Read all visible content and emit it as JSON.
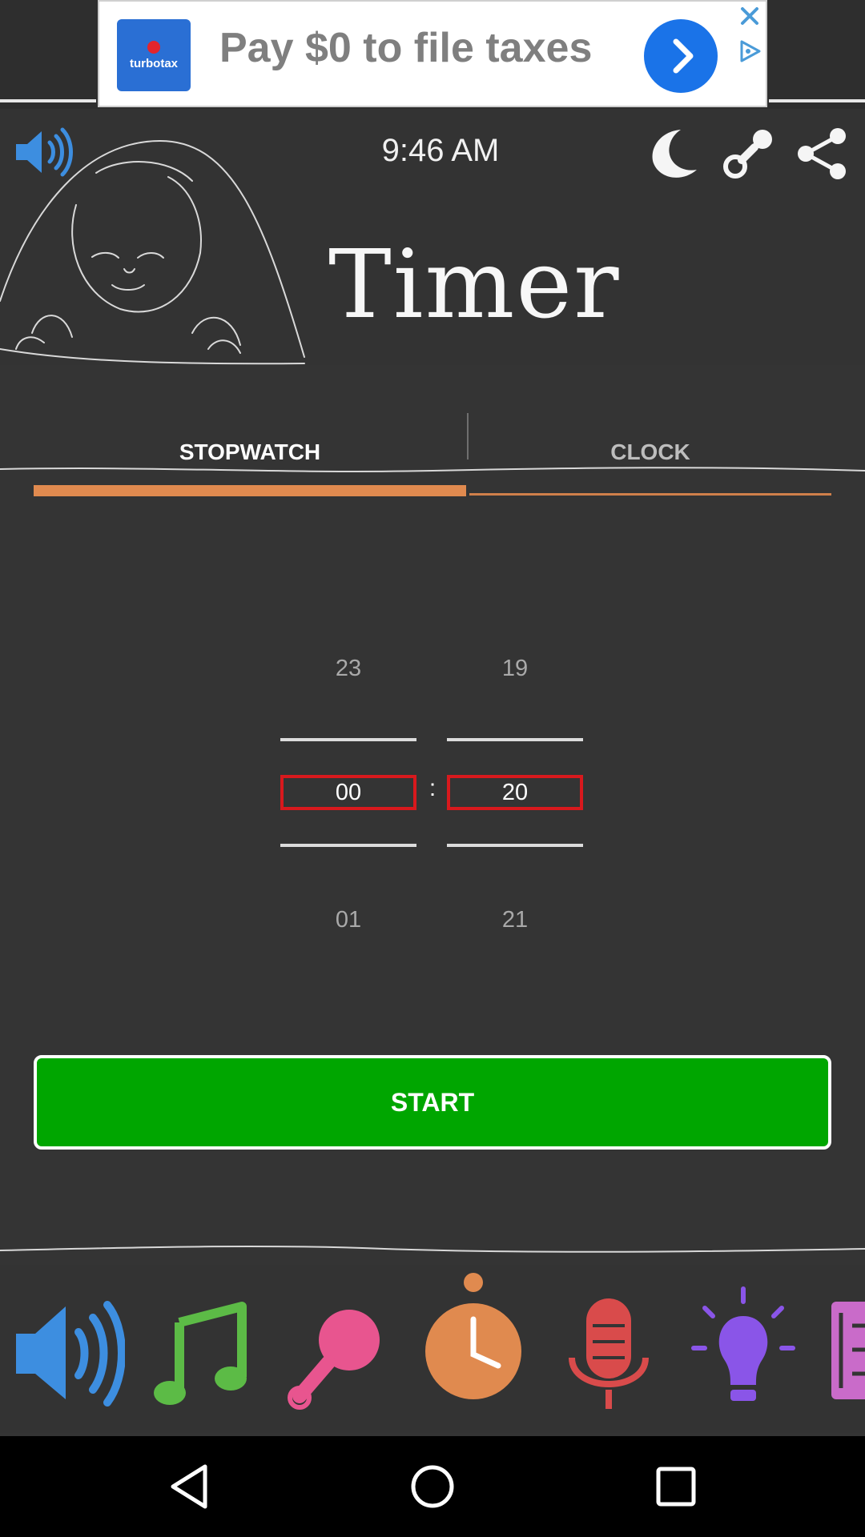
{
  "ad": {
    "headline": "Pay $0 to file taxes",
    "brand": "turbotax",
    "brand_color": "#2a6fd4",
    "cta_color": "#1a73e8",
    "icons": [
      "turbotax-logo",
      "arrow-right-icon",
      "close-icon",
      "adchoices-icon"
    ]
  },
  "header": {
    "time": "9:46 AM",
    "title": "Timer",
    "icons": [
      "volume-icon",
      "moon-icon",
      "pacifier-icon",
      "share-icon"
    ]
  },
  "tabs": [
    {
      "label": "STOPWATCH",
      "active": true
    },
    {
      "label": "CLOCK",
      "active": false
    }
  ],
  "picker": {
    "hours": {
      "above": "23",
      "value": "00",
      "below": "01"
    },
    "minutes": {
      "above": "19",
      "value": "20",
      "below": "21"
    },
    "separator": ":"
  },
  "start_label": "START",
  "toolbar": {
    "items": [
      "speaker-icon",
      "music-note-icon",
      "rattle-icon",
      "timer-icon",
      "microphone-icon",
      "lightbulb-icon",
      "book-icon"
    ]
  },
  "colors": {
    "accent": "#e08a4f",
    "start": "#00a600",
    "picker_border": "#d8191d",
    "background": "#343434"
  },
  "navbar": [
    "back-icon",
    "home-icon",
    "recents-icon"
  ]
}
